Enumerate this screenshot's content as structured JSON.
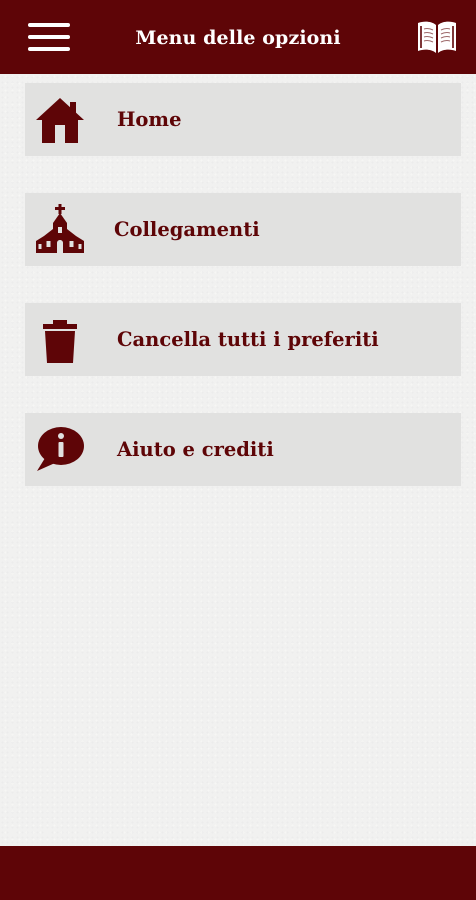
{
  "header": {
    "title": "Menu delle opzioni",
    "menu_icon": "hamburger-menu-icon",
    "book_icon": "open-book-icon"
  },
  "menu": {
    "items": [
      {
        "label": "Home",
        "icon": "home-icon"
      },
      {
        "label": "Collegamenti",
        "icon": "church-icon"
      },
      {
        "label": "Cancella tutti i preferiti",
        "icon": "trash-icon"
      },
      {
        "label": "Aiuto e crediti",
        "icon": "info-bubble-icon"
      }
    ]
  },
  "colors": {
    "brand": "#5e0507",
    "item_background": "#e1e1e0",
    "page_background": "#f1f1f0",
    "header_text": "#ffffff"
  }
}
